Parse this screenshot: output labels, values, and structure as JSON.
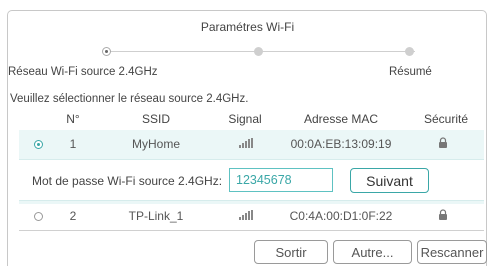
{
  "wizard": {
    "title": "Paramétres Wi-Fi",
    "steps": [
      {
        "label": "Réseau Wi-Fi source 2.4GHz",
        "state": "active"
      },
      {
        "label": "",
        "state": "pending"
      },
      {
        "label": "Résumé",
        "state": "pending"
      }
    ]
  },
  "prompt": "Veuillez sélectionner le réseau source 2.4GHz.",
  "table": {
    "headers": [
      "N°",
      "SSID",
      "Signal",
      "Adresse MAC",
      "Sécurité"
    ],
    "rows": [
      {
        "selected": true,
        "num": "1",
        "ssid": "MyHome",
        "signal_icon": "signal-strength-icon",
        "mac": "00:0A:EB:13:09:19",
        "security_icon": "lock-icon"
      },
      {
        "selected": false,
        "num": "2",
        "ssid": "TP-Link_1",
        "signal_icon": "signal-strength-icon",
        "mac": "C0:4A:00:D1:0F:22",
        "security_icon": "lock-icon"
      }
    ]
  },
  "password": {
    "label": "Mot de passe Wi-Fi source 2.4GHz:",
    "value": "12345678",
    "next_label": "Suivant"
  },
  "footer": {
    "exit_label": "Sortir",
    "other_label": "Autre...",
    "rescan_label": "Rescanner"
  },
  "colors": {
    "accent": "#3aa7a7",
    "row_highlight": "#ebf7f7"
  }
}
